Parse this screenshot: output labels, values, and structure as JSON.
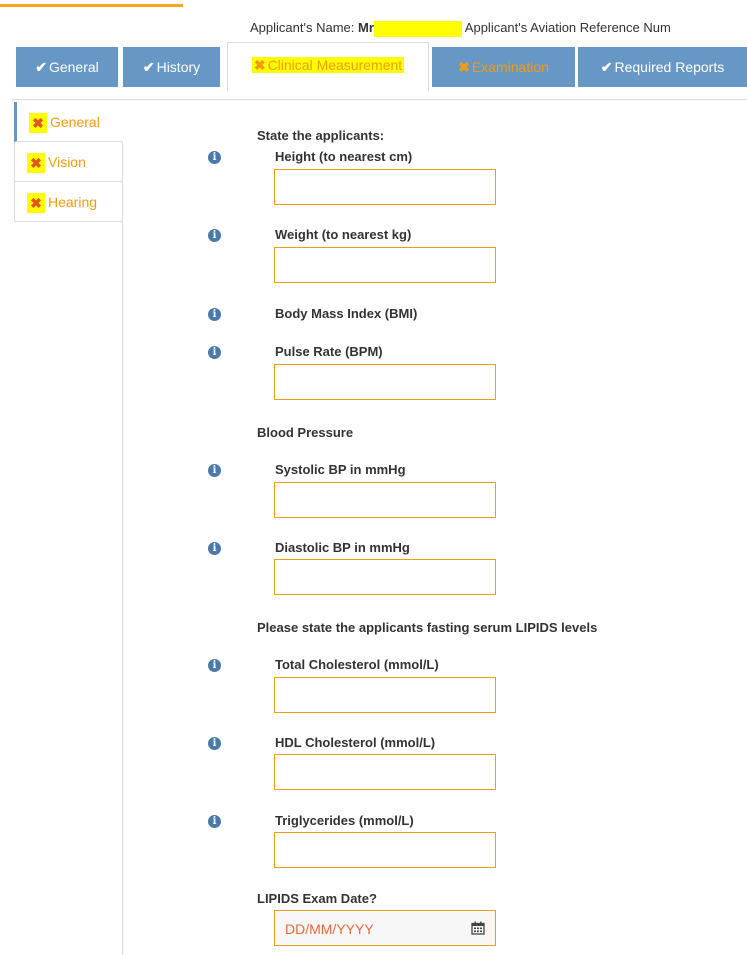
{
  "header": {
    "applicant_name_label": "Applicant's Name:",
    "applicant_name_value": "Mr",
    "reference_label": "Applicant's Aviation Reference Num"
  },
  "tabs": [
    {
      "label": "General",
      "status": "complete"
    },
    {
      "label": "History",
      "status": "complete"
    },
    {
      "label": "Clinical Measurement",
      "status": "incomplete",
      "active": true
    },
    {
      "label": "Examination",
      "status": "incomplete"
    },
    {
      "label": "Required Reports",
      "status": "complete"
    }
  ],
  "sidebar": {
    "items": [
      {
        "label": "General",
        "status": "incomplete",
        "active": true
      },
      {
        "label": "Vision",
        "status": "incomplete"
      },
      {
        "label": "Hearing",
        "status": "incomplete"
      }
    ]
  },
  "form": {
    "state_heading": "State the applicants:",
    "height_label": "Height (to nearest cm)",
    "height_value": "",
    "weight_label": "Weight (to nearest kg)",
    "weight_value": "",
    "bmi_label": "Body Mass Index (BMI)",
    "pulse_label": "Pulse Rate (BPM)",
    "pulse_value": "",
    "bp_heading": "Blood Pressure",
    "systolic_label": "Systolic BP in mmHg",
    "systolic_value": "",
    "diastolic_label": "Diastolic BP in mmHg",
    "diastolic_value": "",
    "lipids_heading": "Please state the applicants fasting serum LIPIDS levels",
    "total_chol_label": "Total Cholesterol (mmol/L)",
    "total_chol_value": "",
    "hdl_label": "HDL Cholesterol (mmol/L)",
    "hdl_value": "",
    "trig_label": "Triglycerides (mmol/L)",
    "trig_value": "",
    "lipids_date_label": "LIPIDS Exam Date?",
    "lipids_date_placeholder": "DD/MM/YYYY"
  },
  "colors": {
    "tab_blue": "#6797c5",
    "incomplete_orange": "#f39c12",
    "highlight_yellow": "#ffff00",
    "info_blue": "#4b79a8"
  },
  "icons": {
    "complete": "check-icon",
    "incomplete": "cross-icon",
    "info": "info-icon",
    "date": "calendar-icon"
  }
}
